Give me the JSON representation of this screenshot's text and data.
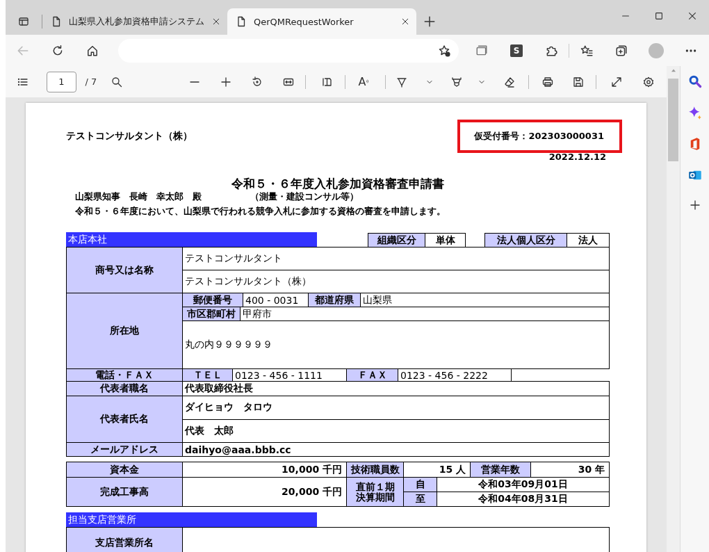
{
  "browser": {
    "tabs": [
      {
        "title": "山梨県入札参加資格申請システム",
        "selected": false
      },
      {
        "title": "QerQMRequestWorker",
        "selected": true
      }
    ],
    "back_disabled": true,
    "extension_label": "S"
  },
  "pdf_toolbar": {
    "page": "1",
    "page_count": "/ 7",
    "read_aloud": "A"
  },
  "document": {
    "company": "テストコンサルタント（株）",
    "receipt_number": "仮受付番号：202303000031",
    "date": "2022.12.12",
    "title": "令和５・６年度入札参加資格審査申請書",
    "addressee": "山梨県知事　長崎　幸太郎　殿",
    "category": "（測量・建設コンサル等）",
    "statement": "令和５・６年度において、山梨県で行われる競争入札に参加する資格の審査を申請します。",
    "head_office": {
      "heading": "本店本社",
      "org_type_label": "組織区分",
      "org_type": "単体",
      "entity_label": "法人個人区分",
      "entity": "法人",
      "name_label": "商号又は名称",
      "name_kana": "テストコンサルタント",
      "name": "テストコンサルタント（株）",
      "address_label": "所在地",
      "postal_label": "郵便番号",
      "postal_code": "400 - 0031",
      "prefecture_label": "都道府県",
      "prefecture": "山梨県",
      "city_label": "市区郡町村",
      "city": "甲府市",
      "street": "丸の内９９９９９９",
      "phone_fax_label": "電話・ＦＡＸ",
      "tel_label": "ＴＥＬ",
      "tel": "0123 - 456 - 1111",
      "fax_label": "ＦＡＸ",
      "fax": "0123 - 456 - 2222",
      "rep_title_label": "代表者職名",
      "rep_title": "代表取締役社長",
      "rep_name_label": "代表者氏名",
      "rep_name_kana": "ダイヒョウ　タロウ",
      "rep_name": "代表　太郎",
      "email_label": "メールアドレス",
      "email": "daihyo@aaa.bbb.cc"
    },
    "finance": {
      "capital_label": "資本金",
      "capital": "10,000 千円",
      "engineers_label": "技術職員数",
      "engineers": "15 人",
      "years_label": "営業年数",
      "years": "30 年",
      "completed_label": "完成工事高",
      "completed": "20,000 千円",
      "period_label": "直前１期決算期間",
      "from_label": "自",
      "from": "令和03年09月01日",
      "to_label": "至",
      "to": "令和04年08月31日"
    },
    "branch": {
      "heading": "担当支店営業所",
      "name_label": "支店営業所名"
    }
  }
}
